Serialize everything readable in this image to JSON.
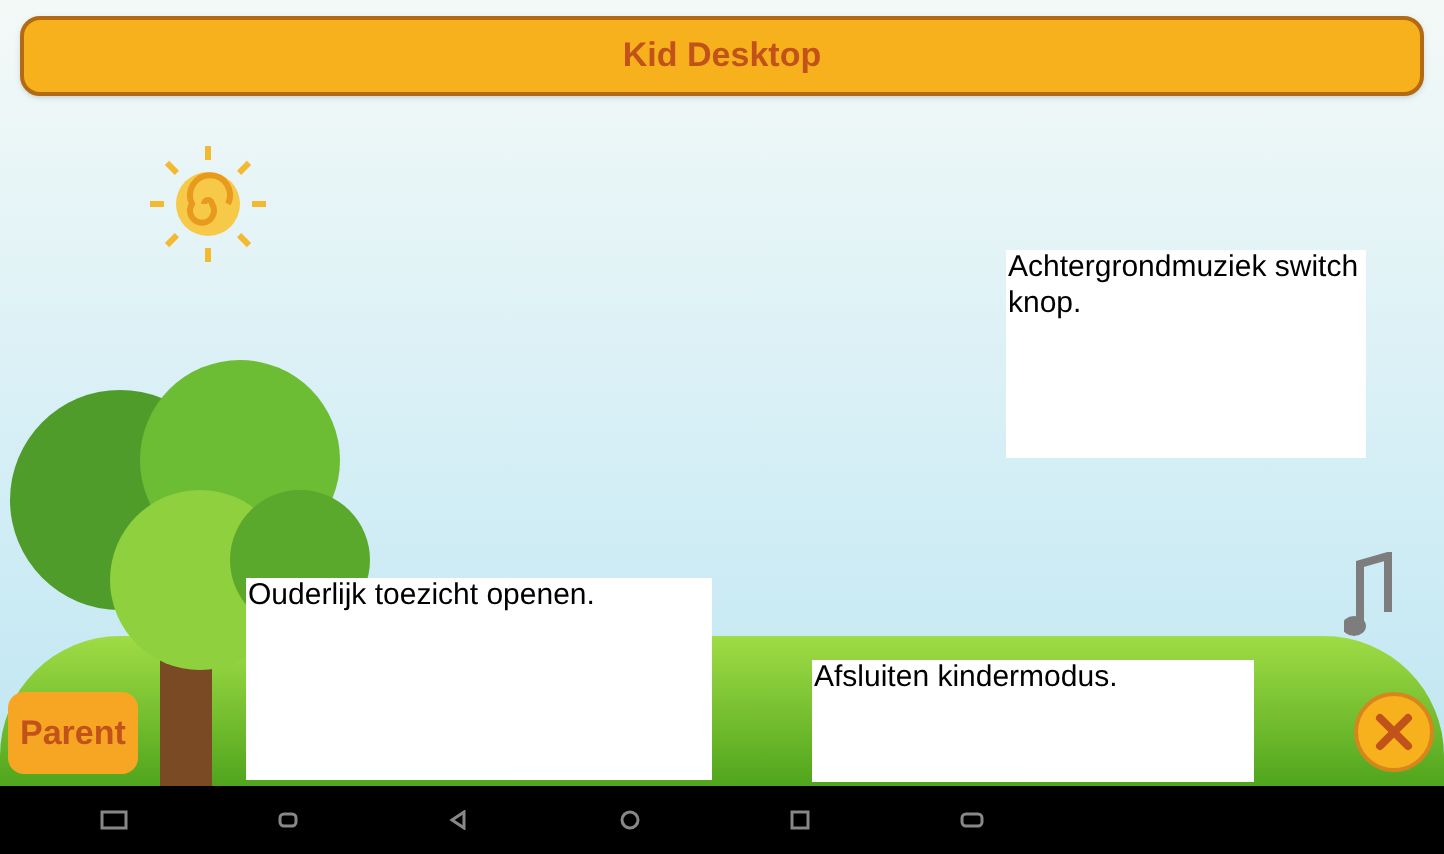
{
  "title_bar": {
    "title": "Kid Desktop"
  },
  "parent_button": {
    "label": "Parent"
  },
  "annotations": [
    {
      "text": "Achtergrondmuziek switch knop."
    },
    {
      "text": "Ouderlijk toezicht openen."
    },
    {
      "text": "Afsluiten kindermodus."
    }
  ]
}
